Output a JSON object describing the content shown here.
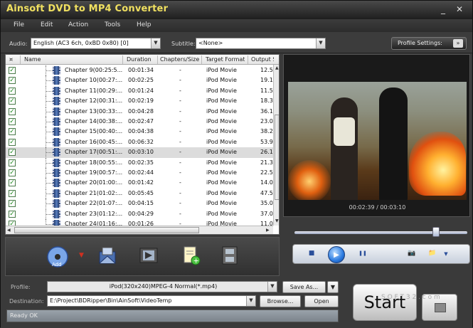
{
  "window": {
    "title": "Ainsoft DVD to MP4 Converter",
    "minimize": "_",
    "close": "✕"
  },
  "menu": [
    "File",
    "Edit",
    "Action",
    "Tools",
    "Help"
  ],
  "toolbar": {
    "audio_label": "Audio:",
    "audio_value": "English (AC3 6ch, 0xBD 0x80) [0]",
    "subtitle_label": "Subtitle:",
    "subtitle_value": "<None>",
    "profile_settings": "Profile Settings:",
    "profile_settings_arrow": "»"
  },
  "list": {
    "columns": [
      "¤",
      "Name",
      "Duration",
      "Chapters/Size",
      "Target Format",
      "Output Siz"
    ],
    "rows": [
      {
        "name": "Chapter 9(00:25:5...",
        "duration": "00:01:34",
        "chapters": "-",
        "format": "iPod Movie",
        "size": "12.5"
      },
      {
        "name": "Chapter 10(00:27:...",
        "duration": "00:02:25",
        "chapters": "-",
        "format": "iPod Movie",
        "size": "19.1"
      },
      {
        "name": "Chapter 11(00:29:...",
        "duration": "00:01:24",
        "chapters": "-",
        "format": "iPod Movie",
        "size": "11.5"
      },
      {
        "name": "Chapter 12(00:31:...",
        "duration": "00:02:19",
        "chapters": "-",
        "format": "iPod Movie",
        "size": "18.3"
      },
      {
        "name": "Chapter 13(00:33:...",
        "duration": "00:04:28",
        "chapters": "-",
        "format": "iPod Movie",
        "size": "36.1"
      },
      {
        "name": "Chapter 14(00:38:...",
        "duration": "00:02:47",
        "chapters": "-",
        "format": "iPod Movie",
        "size": "23.0"
      },
      {
        "name": "Chapter 15(00:40:...",
        "duration": "00:04:38",
        "chapters": "-",
        "format": "iPod Movie",
        "size": "38.2"
      },
      {
        "name": "Chapter 16(00:45:...",
        "duration": "00:06:32",
        "chapters": "-",
        "format": "iPod Movie",
        "size": "53.9"
      },
      {
        "name": "Chapter 17(00:51:...",
        "duration": "00:03:10",
        "chapters": "-",
        "format": "iPod Movie",
        "size": "26.1",
        "selected": true
      },
      {
        "name": "Chapter 18(00:55:...",
        "duration": "00:02:35",
        "chapters": "-",
        "format": "iPod Movie",
        "size": "21.3"
      },
      {
        "name": "Chapter 19(00:57:...",
        "duration": "00:02:44",
        "chapters": "-",
        "format": "iPod Movie",
        "size": "22.5"
      },
      {
        "name": "Chapter 20(01:00:...",
        "duration": "00:01:42",
        "chapters": "-",
        "format": "iPod Movie",
        "size": "14.0"
      },
      {
        "name": "Chapter 21(01:02:...",
        "duration": "00:05:45",
        "chapters": "-",
        "format": "iPod Movie",
        "size": "47.5"
      },
      {
        "name": "Chapter 22(01:07:...",
        "duration": "00:04:15",
        "chapters": "-",
        "format": "iPod Movie",
        "size": "35.0"
      },
      {
        "name": "Chapter 23(01:12:...",
        "duration": "00:04:29",
        "chapters": "-",
        "format": "iPod Movie",
        "size": "37.0"
      },
      {
        "name": "Chapter 24(01:16:...",
        "duration": "00:01:26",
        "chapters": "-",
        "format": "iPod Movie",
        "size": "11.0"
      }
    ]
  },
  "preview": {
    "current_time": "00:02:39",
    "separator": "/",
    "total_time": "00:03:10",
    "seek_fraction": 0.82
  },
  "player": {
    "stop": "■",
    "play": "▶",
    "pause": "❚❚",
    "snapshot": "📷",
    "folder": "📁",
    "menu_arrow": "▼"
  },
  "actions": {
    "add_label": "Add"
  },
  "bottom": {
    "profile_label": "Profile:",
    "profile_value": "iPod(320x240)MPEG-4 Normal(*.mp4)",
    "save_as": "Save As...",
    "destination_label": "Destination:",
    "destination_value": "E:\\Project\\BDRipper\\Bin\\AinSoft\\VideoTemp",
    "browse": "Browse...",
    "open": "Open",
    "start": "Start",
    "status": "Ready OK",
    "watermark": "S O F T 3 2 . c o m"
  },
  "colors": {
    "title": "#f0e060",
    "accent": "#2a7ae0",
    "check": "#1d8a1d"
  }
}
